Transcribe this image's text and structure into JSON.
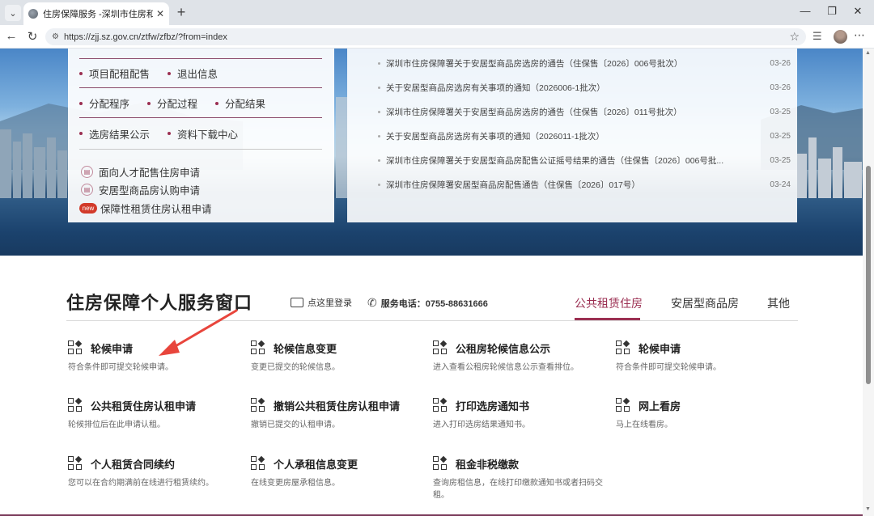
{
  "browser": {
    "tab_title": "住房保障服务 -深圳市住房和建设局",
    "url": "https://zjj.sz.gov.cn/ztfw/zfbz/?from=index"
  },
  "menu": {
    "top_partial": "",
    "row1": [
      "项目配租配售",
      "退出信息"
    ],
    "row2": [
      "分配程序",
      "分配过程",
      "分配结果"
    ],
    "row3": [
      "选房结果公示",
      "资料下载中心"
    ],
    "apply_links": [
      {
        "label": "面向人才配售住房申请",
        "badge": ""
      },
      {
        "label": "安居型商品房认购申请",
        "badge": ""
      },
      {
        "label": "保障性租赁住房认租申请",
        "badge": "new"
      }
    ]
  },
  "news": [
    {
      "title": "深圳市住房保障署关于安居型商品房选房的通告（住保售〔2026〕006号批次）",
      "date": "03-26"
    },
    {
      "title": "关于安居型商品房选房有关事项的通知（2026006-1批次）",
      "date": "03-26"
    },
    {
      "title": "深圳市住房保障署关于安居型商品房选房的通告（住保售〔2026〕011号批次）",
      "date": "03-25"
    },
    {
      "title": "关于安居型商品房选房有关事项的通知（2026011-1批次）",
      "date": "03-25"
    },
    {
      "title": "深圳市住房保障署关于安居型商品房配售公证摇号结果的通告（住保售〔2026〕006号批...",
      "date": "03-25"
    },
    {
      "title": "深圳市住房保障署安居型商品房配售通告（住保售〔2026〕017号）",
      "date": "03-24"
    }
  ],
  "service": {
    "title": "住房保障个人服务窗口",
    "login": "点这里登录",
    "phone": "服务电话：0755-88631666",
    "tabs": [
      "公共租赁住房",
      "安居型商品房",
      "其他"
    ],
    "cards": [
      {
        "title": "轮候申请",
        "desc": "符合条件即可提交轮候申请。"
      },
      {
        "title": "轮候信息变更",
        "desc": "变更已提交的轮候信息。"
      },
      {
        "title": "公租房轮候信息公示",
        "desc": "进入查看公租房轮候信息公示查看排位。"
      },
      {
        "title": "轮候申请",
        "desc": "符合条件即可提交轮候申请。"
      },
      {
        "title": "公共租赁住房认租申请",
        "desc": "轮候排位后在此申请认租。"
      },
      {
        "title": "撤销公共租赁住房认租申请",
        "desc": "撤销已提交的认租申请。"
      },
      {
        "title": "打印选房通知书",
        "desc": "进入打印选房结果通知书。"
      },
      {
        "title": "网上看房",
        "desc": "马上在线看房。"
      },
      {
        "title": "个人租赁合同续约",
        "desc": "您可以在合约期满前在线进行租赁续约。"
      },
      {
        "title": "个人承租信息变更",
        "desc": "在线变更房屋承租信息。"
      },
      {
        "title": "租金非税缴款",
        "desc": "查询房租信息，在线打印缴款通知书或者扫码交租。"
      }
    ]
  },
  "colors": {
    "accent": "#9b2f52",
    "arrow": "#e8453c"
  }
}
